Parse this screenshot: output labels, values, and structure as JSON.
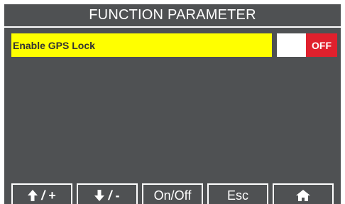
{
  "header": {
    "title": "FUNCTION PARAMETER"
  },
  "parameter": {
    "label": "Enable GPS Lock",
    "state": "OFF"
  },
  "softkeys": {
    "up": {
      "icon": "arrow-up-icon",
      "label": "+"
    },
    "down": {
      "icon": "arrow-down-icon",
      "label": "-"
    },
    "onoff": {
      "label": "On/Off"
    },
    "esc": {
      "label": "Esc"
    },
    "home": {
      "icon": "home-icon"
    }
  },
  "colors": {
    "background": "#4f5153",
    "highlight": "#ffff00",
    "off_state": "#e0202d",
    "text": "#ffffff"
  }
}
